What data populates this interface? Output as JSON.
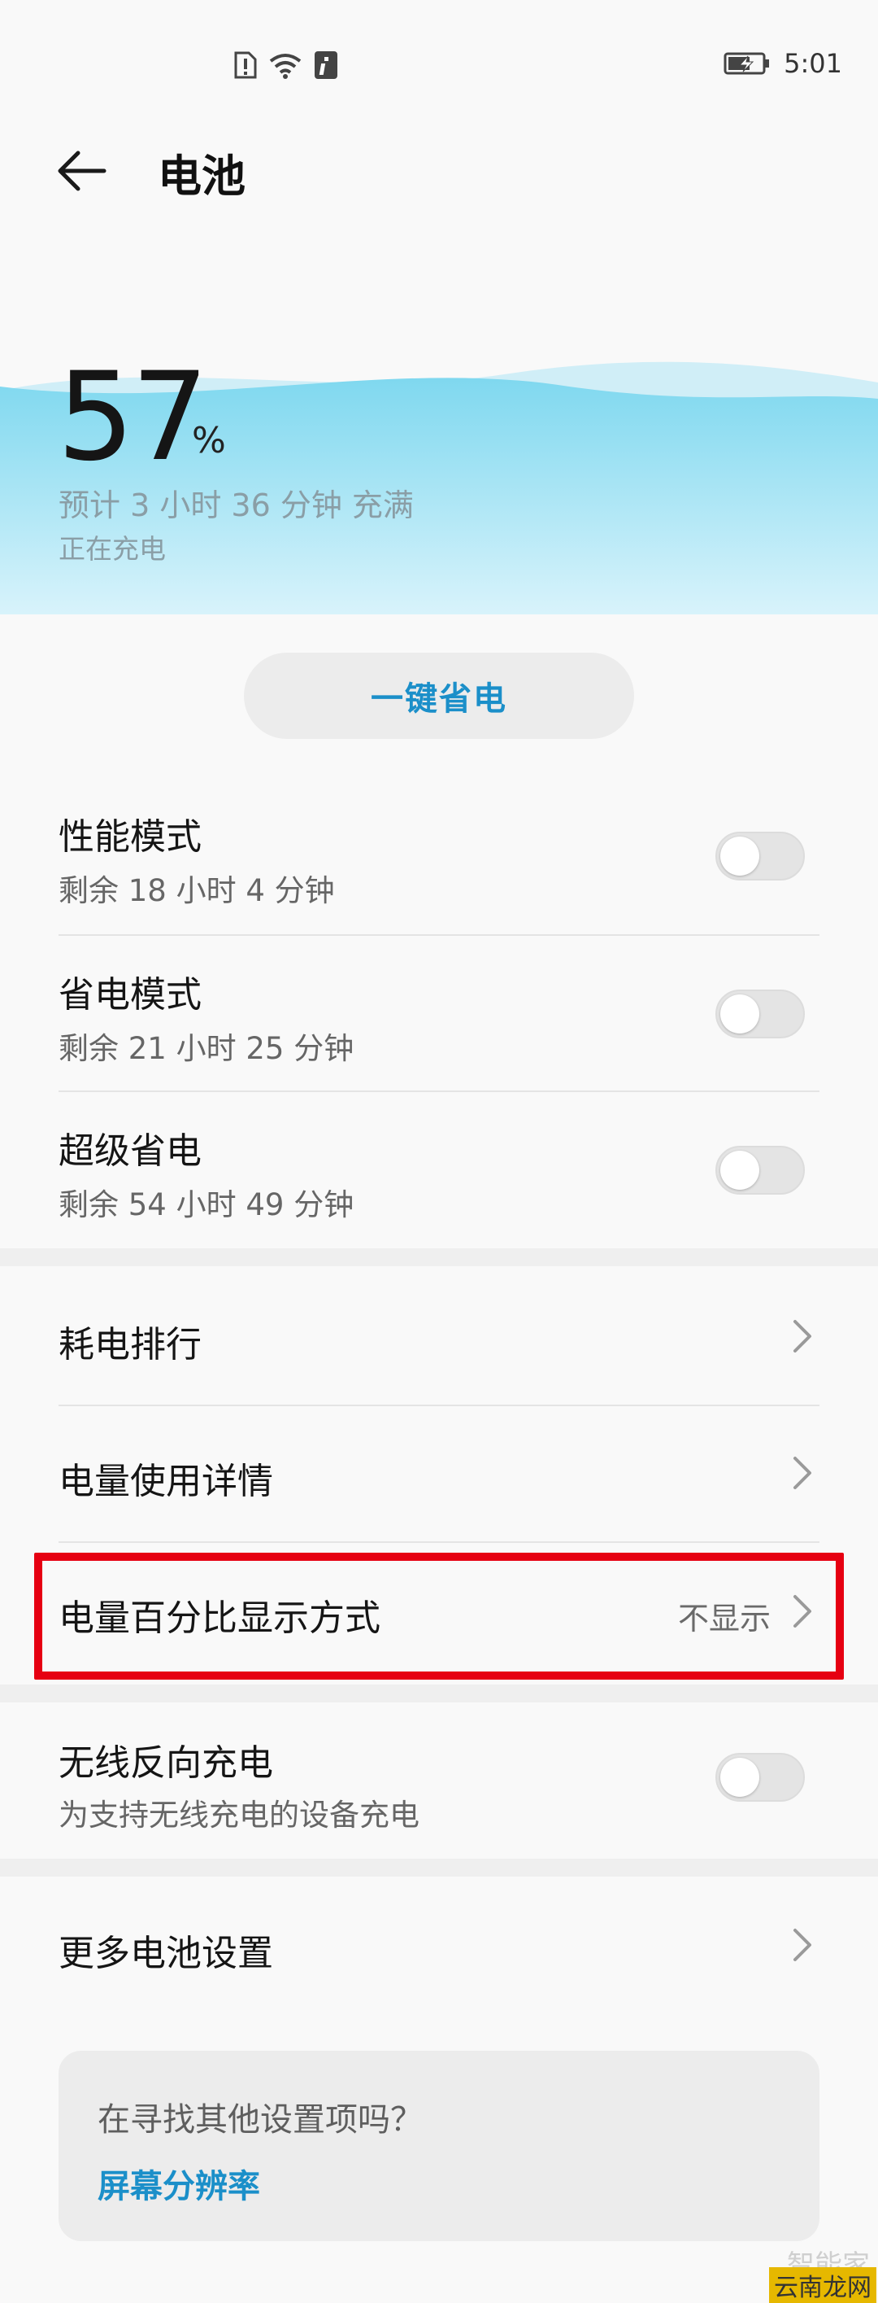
{
  "status_bar": {
    "time": "5:01"
  },
  "header": {
    "title": "电池"
  },
  "battery": {
    "percent": "57",
    "percent_sign": "%",
    "estimate": "预计 3 小时 36 分钟 充满",
    "status": "正在充电"
  },
  "save_button": {
    "label": "一键省电"
  },
  "modes": [
    {
      "title": "性能模式",
      "subtitle": "剩余 18 小时 4 分钟",
      "enabled": false
    },
    {
      "title": "省电模式",
      "subtitle": "剩余 21 小时 25 分钟",
      "enabled": false
    },
    {
      "title": "超级省电",
      "subtitle": "剩余 54 小时 49 分钟",
      "enabled": false
    }
  ],
  "menu": {
    "ranking": "耗电排行",
    "usage_details": "电量使用详情",
    "percent_display": {
      "title": "电量百分比显示方式",
      "value": "不显示"
    },
    "wireless_reverse": {
      "title": "无线反向充电",
      "subtitle": "为支持无线充电的设备充电",
      "enabled": false
    },
    "more_settings": "更多电池设置"
  },
  "search_card": {
    "question": "在寻找其他设置项吗？",
    "link": "屏幕分辨率"
  },
  "watermark": {
    "line1": "智能家",
    "line2": "云南龙网"
  },
  "colors": {
    "accent": "#1b8fc9",
    "highlight_border": "#e60012",
    "wave_top": "#78d6ee",
    "wave_bottom": "#d6f2fa"
  },
  "icons": [
    "sim-alert-icon",
    "wifi-icon",
    "info-icon",
    "battery-charging-icon",
    "back-arrow-icon",
    "chevron-right-icon"
  ]
}
